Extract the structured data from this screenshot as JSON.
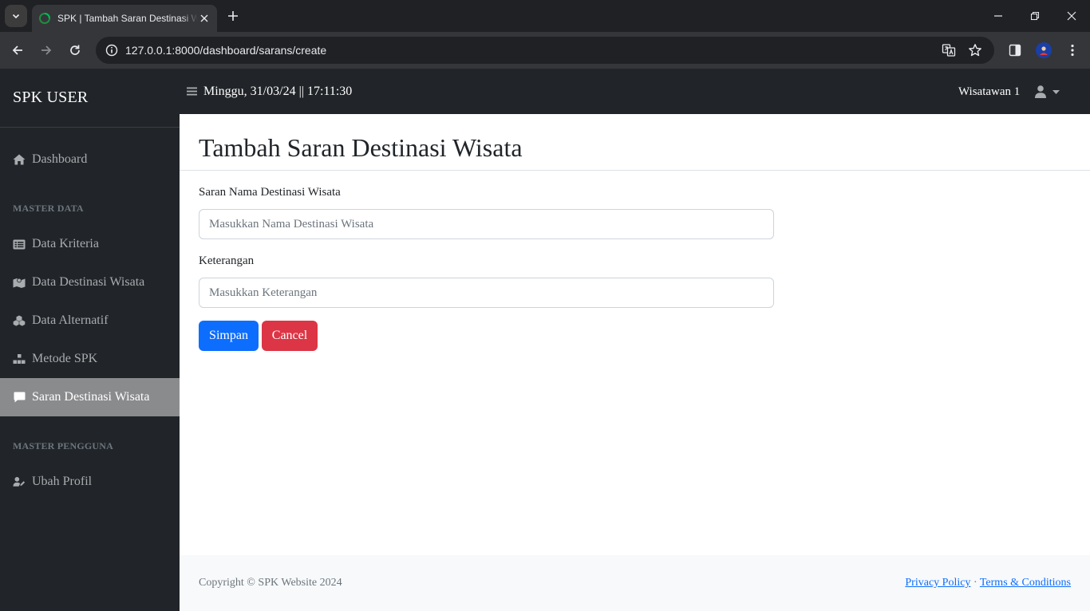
{
  "browser": {
    "tab_title": "SPK | Tambah Saran Destinasi Wisata",
    "url": "127.0.0.1:8000/dashboard/sarans/create"
  },
  "sidebar": {
    "brand": "SPK USER",
    "items": [
      {
        "label": "Dashboard",
        "icon": "home-icon"
      },
      {
        "label": "Data Kriteria",
        "icon": "list-icon"
      },
      {
        "label": "Data Destinasi Wisata",
        "icon": "map-icon"
      },
      {
        "label": "Data Alternatif",
        "icon": "cubes-icon"
      },
      {
        "label": "Metode SPK",
        "icon": "cubes-stacked-icon"
      },
      {
        "label": "Saran Destinasi Wisata",
        "icon": "comment-icon",
        "active": true
      },
      {
        "label": "Ubah Profil",
        "icon": "user-pen-icon"
      }
    ],
    "headings": [
      "MASTER DATA",
      "MASTER PENGGUNA"
    ]
  },
  "topnav": {
    "datetime": "Minggu, 31/03/24 || 17:11:30",
    "username": "Wisatawan 1"
  },
  "main": {
    "title": "Tambah Saran Destinasi Wisata",
    "fields": [
      {
        "label": "Saran Nama Destinasi Wisata",
        "placeholder": "Masukkan Nama Destinasi Wisata",
        "value": ""
      },
      {
        "label": "Keterangan",
        "placeholder": "Masukkan Keterangan",
        "value": ""
      }
    ],
    "buttons": {
      "save": "Simpan",
      "cancel": "Cancel"
    }
  },
  "footer": {
    "copyright": "Copyright © SPK Website 2024",
    "privacy": "Privacy Policy",
    "separator": "·",
    "terms": "Terms & Conditions"
  },
  "colors": {
    "sidebar_bg": "#212529",
    "active_item_bg": "#8a8b8d",
    "primary": "#0d6efd",
    "danger": "#dc3545",
    "footer_bg": "#f8f9fa"
  }
}
